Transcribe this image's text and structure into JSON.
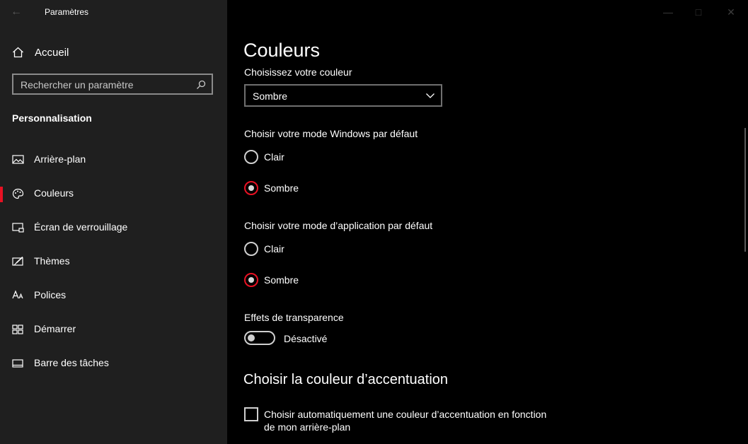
{
  "window": {
    "title": "Paramètres",
    "controls": [
      "minimize",
      "maximize",
      "close"
    ]
  },
  "sidebar": {
    "home_label": "Accueil",
    "search_placeholder": "Rechercher un paramètre",
    "section_title": "Personnalisation",
    "items": [
      {
        "label": "Arrière-plan",
        "icon": "picture-icon"
      },
      {
        "label": "Couleurs",
        "icon": "palette-icon",
        "active": true
      },
      {
        "label": "Écran de verrouillage",
        "icon": "lock-screen-icon"
      },
      {
        "label": "Thèmes",
        "icon": "themes-icon"
      },
      {
        "label": "Polices",
        "icon": "fonts-icon"
      },
      {
        "label": "Démarrer",
        "icon": "start-icon"
      },
      {
        "label": "Barre des tâches",
        "icon": "taskbar-icon"
      }
    ]
  },
  "main": {
    "title": "Couleurs",
    "color_label": "Choisissez votre couleur",
    "color_value": "Sombre",
    "windows_mode": {
      "label": "Choisir votre mode Windows par défaut",
      "options": [
        "Clair",
        "Sombre"
      ],
      "selected": "Sombre"
    },
    "app_mode": {
      "label": "Choisir votre mode d’application par défaut",
      "options": [
        "Clair",
        "Sombre"
      ],
      "selected": "Sombre"
    },
    "transparency": {
      "label": "Effets de transparence",
      "state": "Désactivé"
    },
    "accent_heading": "Choisir la couleur d’accentuation",
    "auto_accent_label_line1": "Choisir automatiquement une couleur d’accentuation en fonction",
    "auto_accent_label_line2": "de mon arrière-plan"
  },
  "colors": {
    "accent": "#e81123",
    "sidebar_bg": "#1f1f1f",
    "main_bg": "#000000"
  }
}
